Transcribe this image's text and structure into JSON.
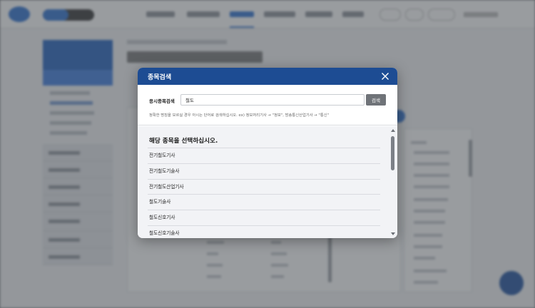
{
  "modal": {
    "title": "종목검색",
    "close_icon": "close-icon",
    "search_label": "응시종목검색",
    "search_value": "철도",
    "search_button": "검색",
    "hint": "정확한 명칭을 모르실 경우 아시는 단어로 검색하십시오. ex) 정보처리기사 → \"정보\", 방송통신산업기사 → \"통신\"",
    "results_title": "해당 종목을 선택하십시오.",
    "results": [
      "전기철도기사",
      "전기철도기술사",
      "전기철도산업기사",
      "철도기술사",
      "철도신호기사",
      "철도신호기술사"
    ]
  },
  "colors": {
    "header": "#1d4c93",
    "search_button": "#6f7378",
    "results_bg": "#f2f3f6"
  }
}
